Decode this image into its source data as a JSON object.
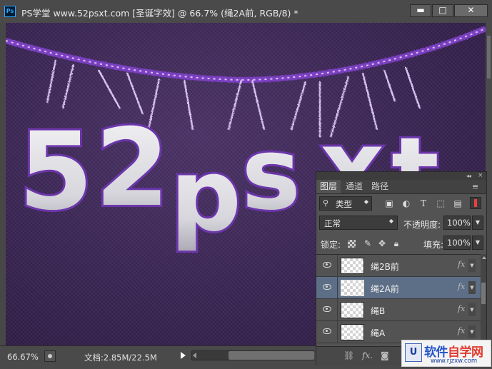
{
  "window": {
    "logo": "Ps",
    "title": "PS学堂 www.52psxt.com [圣诞字效] @ 66.7% (绳2A前, RGB/8) *",
    "minimize": "▬",
    "maximize": "□",
    "close": "✕"
  },
  "canvas": {
    "artwork_text": "52psxt",
    "background_color": "#3a2554",
    "accent_color": "#8a4fd0"
  },
  "status": {
    "zoom": "66.67%",
    "doc_info": "文档:2.85M/22.5M"
  },
  "layers_panel": {
    "tabs": [
      {
        "label": "图层",
        "active": true
      },
      {
        "label": "通道",
        "active": false
      },
      {
        "label": "路径",
        "active": false
      }
    ],
    "menu_icon": "≡",
    "collapse_icon": "◂◂",
    "close_icon": "×",
    "filter_kind": "类型",
    "filter_icons": [
      "image-filter-icon",
      "adjustment-filter-icon",
      "type-filter-icon",
      "shape-filter-icon",
      "smartobject-filter-icon"
    ],
    "blend_mode": "正常",
    "opacity_label": "不透明度:",
    "opacity_value": "100%",
    "lock_label": "锁定:",
    "fill_label": "填充:",
    "fill_value": "100%",
    "layers": [
      {
        "name": "绳2B前",
        "fx": "fx",
        "selected": false,
        "visible": true
      },
      {
        "name": "绳2A前",
        "fx": "fx",
        "selected": true,
        "visible": true
      },
      {
        "name": "绳B",
        "fx": "fx",
        "selected": false,
        "visible": true
      },
      {
        "name": "绳A",
        "fx": "fx",
        "selected": false,
        "visible": true
      }
    ],
    "bottom_icons": [
      "link-icon",
      "fx-icon",
      "mask-icon"
    ],
    "bottom_fx": "fx."
  },
  "watermark": {
    "logo": "U",
    "text_a": "软件",
    "text_b": "自学网",
    "url": "www.rjzxw.com",
    "blue": "#2453c9",
    "red": "#e23a2f"
  }
}
